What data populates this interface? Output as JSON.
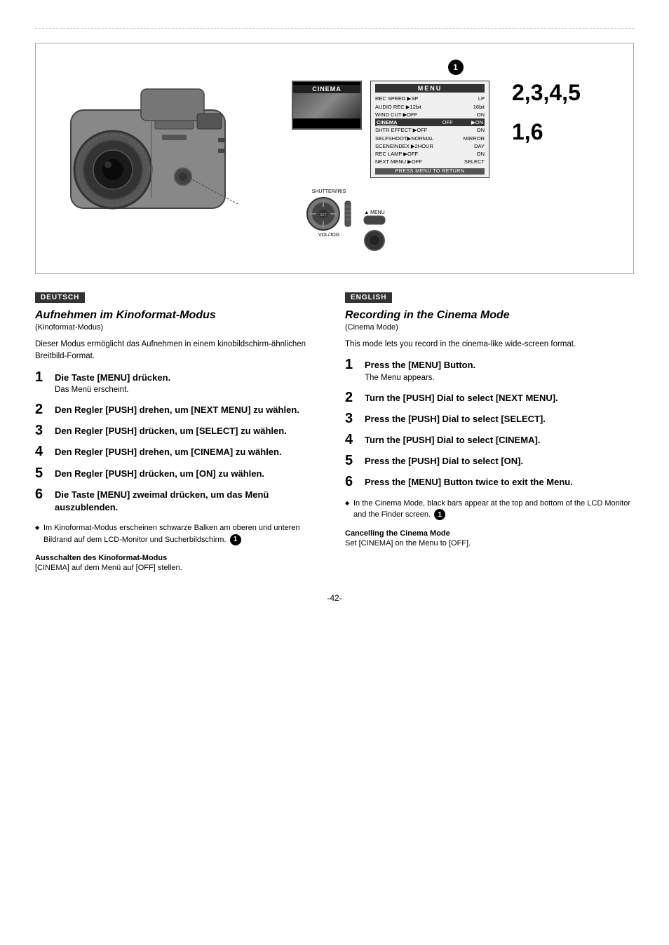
{
  "page": {
    "number": "-42-"
  },
  "diagram": {
    "step1_badge": "1",
    "cinema_label": "CINEMA",
    "menu": {
      "title": "MENU",
      "rows": [
        {
          "left": "REC SPEED ▶SP",
          "right": "LP"
        },
        {
          "left": "AUDIO REC ▶12bit",
          "right": "16bit"
        },
        {
          "left": "WIND CUT  ▶OFF",
          "right": "ON"
        },
        {
          "left": "CINEMA      OFF",
          "right": "▶ON",
          "highlight": true
        },
        {
          "left": "SHTR EFFECT  ▶OFF",
          "right": "ON"
        },
        {
          "left": "SELFSHOOT▶NORMAL",
          "right": "MIRROR"
        },
        {
          "left": "SCENEINDEX  ▶2HOUR",
          "right": "DAY"
        },
        {
          "left": "REC LAMP  ▶OFF",
          "right": "ON"
        },
        {
          "left": "NEXT MENU ▶OFF",
          "right": "SELECT"
        }
      ],
      "return_label": "PRESS MENU TO RETURN"
    },
    "steps_right_top": "2,3,4,5",
    "steps_right_bottom": "1,6",
    "shutter_iris_label": "SHUTTER/IRIS",
    "vol_jog_label": "VOL/JOG",
    "menu_label": "▲ MENU"
  },
  "deutsch": {
    "header": "DEUTSCH",
    "title": "Aufnehmen im Kinoformat-Modus",
    "subtitle": "(Kinoformat-Modus)",
    "intro": "Dieser Modus ermöglicht das Aufnehmen in einem kinobildschirm-ähnlichen Breitbild-Format.",
    "steps": [
      {
        "number": "1",
        "main": "Die Taste [MENU] drücken.",
        "sub": "Das Menü erscheint."
      },
      {
        "number": "2",
        "main": "Den Regler [PUSH] drehen, um [NEXT MENU] zu wählen.",
        "sub": ""
      },
      {
        "number": "3",
        "main": "Den Regler [PUSH] drücken, um [SELECT] zu wählen.",
        "sub": ""
      },
      {
        "number": "4",
        "main": "Den Regler [PUSH] drehen, um [CINEMA] zu wählen.",
        "sub": ""
      },
      {
        "number": "5",
        "main": "Den Regler [PUSH] drücken, um [ON] zu wählen.",
        "sub": ""
      },
      {
        "number": "6",
        "main": "Die Taste [MENU] zweimal drücken, um das Menü auszublenden.",
        "sub": ""
      }
    ],
    "note": "Im Kinoformat-Modus erscheinen schwarze Balken am oberen und unteren Bildrand auf dem LCD-Monitor und Sucherbildschirm.",
    "cancelling_header": "Ausschalten des Kinoformat-Modus",
    "cancelling_text": "[CINEMA] auf dem Menü auf [OFF] stellen."
  },
  "english": {
    "header": "ENGLISH",
    "title": "Recording in the Cinema Mode",
    "subtitle": "(Cinema Mode)",
    "intro": "This mode lets you record in the cinema-like wide-screen format.",
    "steps": [
      {
        "number": "1",
        "main": "Press the [MENU] Button.",
        "sub": "The Menu appears."
      },
      {
        "number": "2",
        "main": "Turn the [PUSH] Dial to select [NEXT MENU].",
        "sub": ""
      },
      {
        "number": "3",
        "main": "Press the [PUSH] Dial to select [SELECT].",
        "sub": ""
      },
      {
        "number": "4",
        "main": "Turn the [PUSH] Dial to select [CINEMA].",
        "sub": ""
      },
      {
        "number": "5",
        "main": "Press the [PUSH] Dial to select [ON].",
        "sub": ""
      },
      {
        "number": "6",
        "main": "Press the [MENU] Button twice to exit the Menu.",
        "sub": ""
      }
    ],
    "note": "In the Cinema Mode, black bars appear at the top and bottom of the LCD Monitor and the Finder screen.",
    "cancelling_header": "Cancelling the Cinema Mode",
    "cancelling_text": "Set [CINEMA] on the Menu to [OFF]."
  }
}
